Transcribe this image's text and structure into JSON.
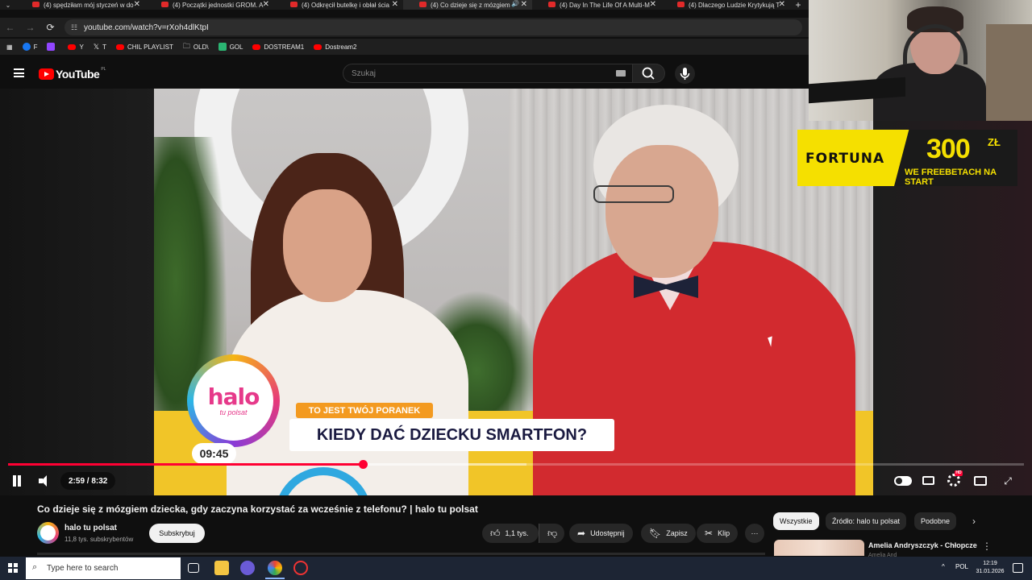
{
  "browser": {
    "tabs": [
      {
        "title": "(4) spędziłam mój styczeń w do",
        "active": false,
        "audio": false
      },
      {
        "title": "(4) Początki jednostki GROM. A",
        "active": false,
        "audio": false
      },
      {
        "title": "(4) Odkręcił butelkę i obłał ścia",
        "active": false,
        "audio": false
      },
      {
        "title": "(4) Co dzieje się z mózgiem",
        "active": true,
        "audio": true
      },
      {
        "title": "(4) Day In The Life Of A Multi-M",
        "active": false,
        "audio": false
      },
      {
        "title": "(4) Dlaczego Ludzie Krytykują T",
        "active": false,
        "audio": false
      }
    ],
    "tab_close_glyph": "✕",
    "new_tab_glyph": "+",
    "tab_menu_glyph": "⌄",
    "url": "youtube.com/watch?v=rXoh4dlKtpI",
    "bookmarks": [
      {
        "label": "F",
        "icon": "facebook-icon",
        "color": "#1877f2"
      },
      {
        "label": "",
        "icon": "twitch-icon",
        "color": "#9146ff"
      },
      {
        "label": "Y",
        "icon": "youtube-icon",
        "color": "#ff0000"
      },
      {
        "label": "T",
        "icon": "x-icon",
        "color": "#ffffff"
      },
      {
        "label": "CHIL PLAYLIST",
        "icon": "youtube-icon",
        "color": "#ff0000"
      },
      {
        "label": "OLD\\",
        "icon": "folder-icon",
        "color": "#cccccc"
      },
      {
        "label": "GOL",
        "icon": "g-icon",
        "color": "#2bb673"
      },
      {
        "label": "DOSTREAM1",
        "icon": "youtube-icon",
        "color": "#ff0000"
      },
      {
        "label": "Dostream2",
        "icon": "youtube-icon",
        "color": "#ff0000"
      }
    ]
  },
  "youtube": {
    "logo_word": "YouTube",
    "logo_country": "PL",
    "search_placeholder": "Szukaj"
  },
  "player": {
    "overlay_show_logo": "halo",
    "overlay_show_sub": "tu polsat",
    "overlay_clock": "09:45",
    "overlay_tag": "TO JEST TWÓJ PORANEK",
    "overlay_headline": "KIEDY DAĆ DZIECKU SMARTFON?",
    "time_display": "2:59 / 8:32",
    "progress_fraction": 0.349,
    "buffered_fraction": 0.51,
    "settings_badge": "HD"
  },
  "ad": {
    "brand": "FORTUNA",
    "amount": "300",
    "currency": "ZŁ",
    "promo": "WE FREEBETACH NA START"
  },
  "video": {
    "title": "Co dzieje się z mózgiem dziecka, gdy zaczyna korzystać za wcześnie z telefonu? | halo tu polsat",
    "channel_name": "halo tu polsat",
    "channel_subs": "11,8 tys. subskrybentów",
    "subscribe_label": "Subskrybuj",
    "likes": "1,1 tys.",
    "share_label": "Udostępnij",
    "save_label": "Zapisz",
    "clip_label": "Klip",
    "more_glyph": "···"
  },
  "chips": [
    "Wszystkie",
    "Źródło: halo tu polsat",
    "Podobne"
  ],
  "recommendation": {
    "title": "Amelia Andryszczyk - Chłopcze",
    "channel": "Amelia And"
  },
  "taskbar": {
    "search_placeholder": "Type here to search",
    "language": "POL",
    "time": "12:19",
    "date": "31.01.2026"
  }
}
